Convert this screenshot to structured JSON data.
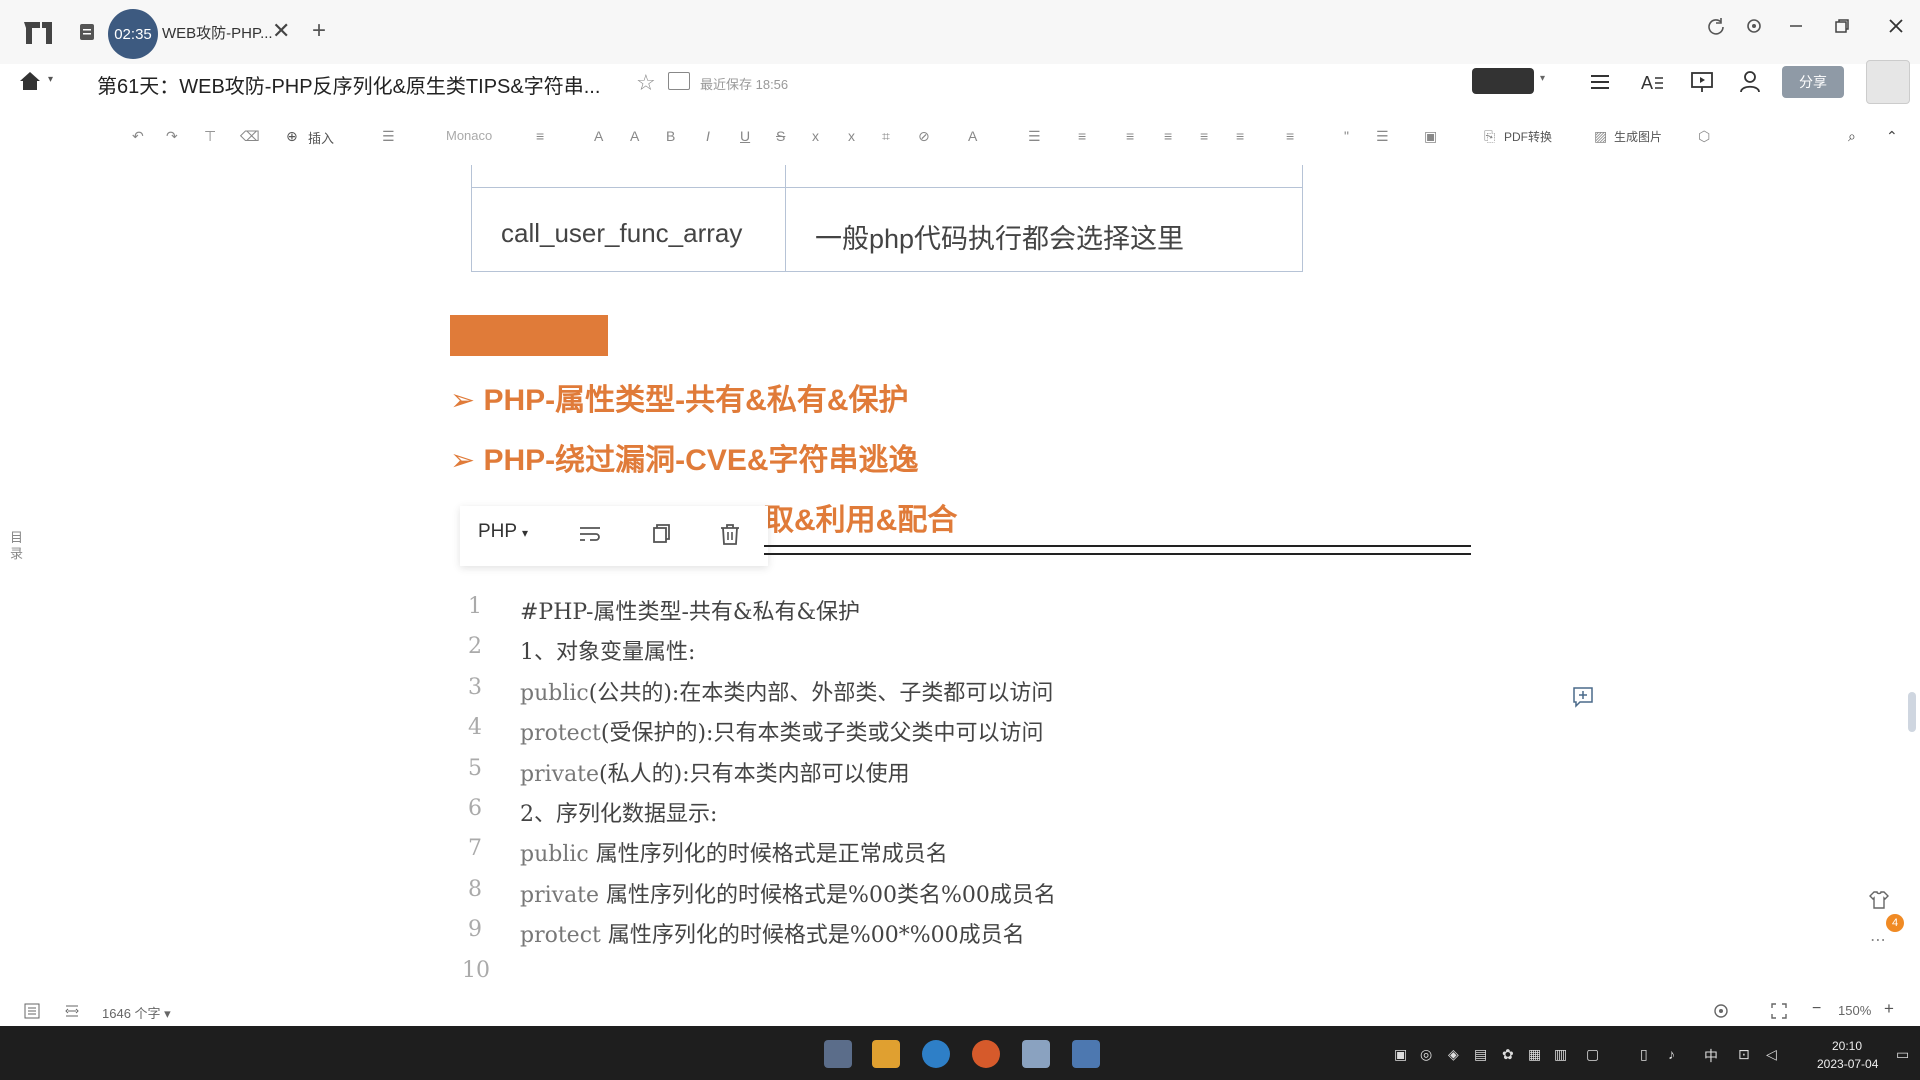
{
  "titlebar": {
    "timer": "02:35",
    "tab_title": "WEB攻防-PHP...",
    "tab_close": "✕",
    "new_tab": "+"
  },
  "header": {
    "doc_title": "第61天：WEB攻防-PHP反序列化&原生类TIPS&字符串...",
    "save_status": "最近保存 18:56",
    "share_label": "分享"
  },
  "toolbar": {
    "insert_label": "插入",
    "font_name": "Monaco",
    "pdf_label": "PDF转换",
    "image_label": "生成图片"
  },
  "sidebar": {
    "outline_label": "目录"
  },
  "table": {
    "func": "call_user_func_array",
    "desc": "一般php代码执行都会选择这里"
  },
  "headings": [
    "PHP-属性类型-共有&私有&保护",
    "PHP-绕过漏洞-CVE&字符串逃逸",
    "取&利用&配合"
  ],
  "bullet_glyph": "➢",
  "codeblock": {
    "language": "PHP",
    "lines": [
      {
        "num": "1",
        "kw": "",
        "text": "#PHP-属性类型-共有&私有&保护"
      },
      {
        "num": "2",
        "kw": "",
        "text": "1、对象变量属性:"
      },
      {
        "num": "3",
        "kw": "public",
        "text": "(公共的):在本类内部、外部类、子类都可以访问"
      },
      {
        "num": "4",
        "kw": "protect",
        "text": "(受保护的):只有本类或子类或父类中可以访问"
      },
      {
        "num": "5",
        "kw": "private",
        "text": "(私人的):只有本类内部可以使用"
      },
      {
        "num": "6",
        "kw": "",
        "text": "2、序列化数据显示:"
      },
      {
        "num": "7",
        "kw": "public",
        "text": " 属性序列化的时候格式是正常成员名"
      },
      {
        "num": "8",
        "kw": "private",
        "text": " 属性序列化的时候格式是%00类名%00成员名"
      },
      {
        "num": "9",
        "kw": "protect",
        "text": " 属性序列化的时候格式是%00*%00成员名"
      },
      {
        "num": "10",
        "kw": "",
        "text": ""
      }
    ]
  },
  "statusbar": {
    "word_count": "1646 个字",
    "zoom": "150%"
  },
  "notifications": {
    "badge": "4"
  },
  "taskbar": {
    "ime": "中",
    "time": "20:10",
    "date": "2023-07-04"
  },
  "colors": {
    "accent_orange": "#e07b39",
    "table_border": "#b6c3d6",
    "timer_bg": "#3d5a80"
  }
}
